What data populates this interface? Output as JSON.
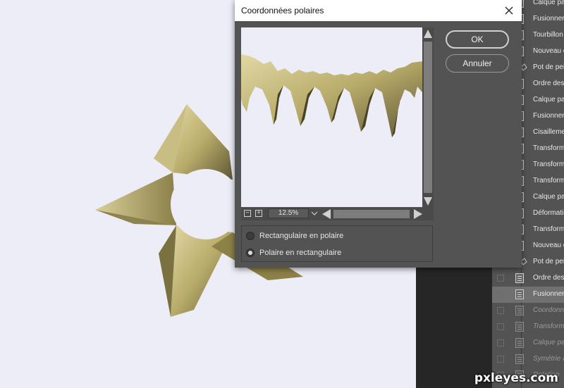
{
  "dialog": {
    "title": "Coordonnées polaires",
    "ok_label": "OK",
    "cancel_label": "Annuler",
    "zoom": "12.5%",
    "options": [
      {
        "label": "Rectangulaire en polaire",
        "checked": false
      },
      {
        "label": "Polaire en rectangulaire",
        "checked": true
      }
    ]
  },
  "history": {
    "items": [
      {
        "label": "Calque pa",
        "state": "normal"
      },
      {
        "label": "Fusionner",
        "state": "normal"
      },
      {
        "label": "Tourbillon",
        "state": "normal"
      },
      {
        "label": "Nouveau c",
        "state": "normal"
      },
      {
        "label": "Pot de pei",
        "state": "normal",
        "icon": "paint-bucket-icon"
      },
      {
        "label": "Ordre des",
        "state": "normal"
      },
      {
        "label": "Calque pa",
        "state": "normal"
      },
      {
        "label": "Fusionner",
        "state": "normal"
      },
      {
        "label": "Cisaillemen",
        "state": "normal"
      },
      {
        "label": "Transform",
        "state": "normal"
      },
      {
        "label": "Transform",
        "state": "normal"
      },
      {
        "label": "Transform",
        "state": "normal"
      },
      {
        "label": "Calque pa",
        "state": "normal"
      },
      {
        "label": "Déformatio",
        "state": "normal"
      },
      {
        "label": "Transform",
        "state": "normal"
      },
      {
        "label": "Nouveau c",
        "state": "normal"
      },
      {
        "label": "Pot de pei",
        "state": "normal",
        "icon": "paint-bucket-icon"
      },
      {
        "label": "Ordre des",
        "state": "normal"
      },
      {
        "label": "Fusionner",
        "state": "active"
      },
      {
        "label": "Coordonn",
        "state": "dim"
      },
      {
        "label": "Transform",
        "state": "dim"
      },
      {
        "label": "Calque pa",
        "state": "dim"
      },
      {
        "label": "Symétrie a",
        "state": "dim"
      },
      {
        "label": "Rotation",
        "state": "dim"
      }
    ]
  },
  "watermark": "pxleyes.com",
  "colors": {
    "canvas_bg": "#ecedf7",
    "panel_bg": "#535353",
    "gold": "#c9bd7d"
  }
}
